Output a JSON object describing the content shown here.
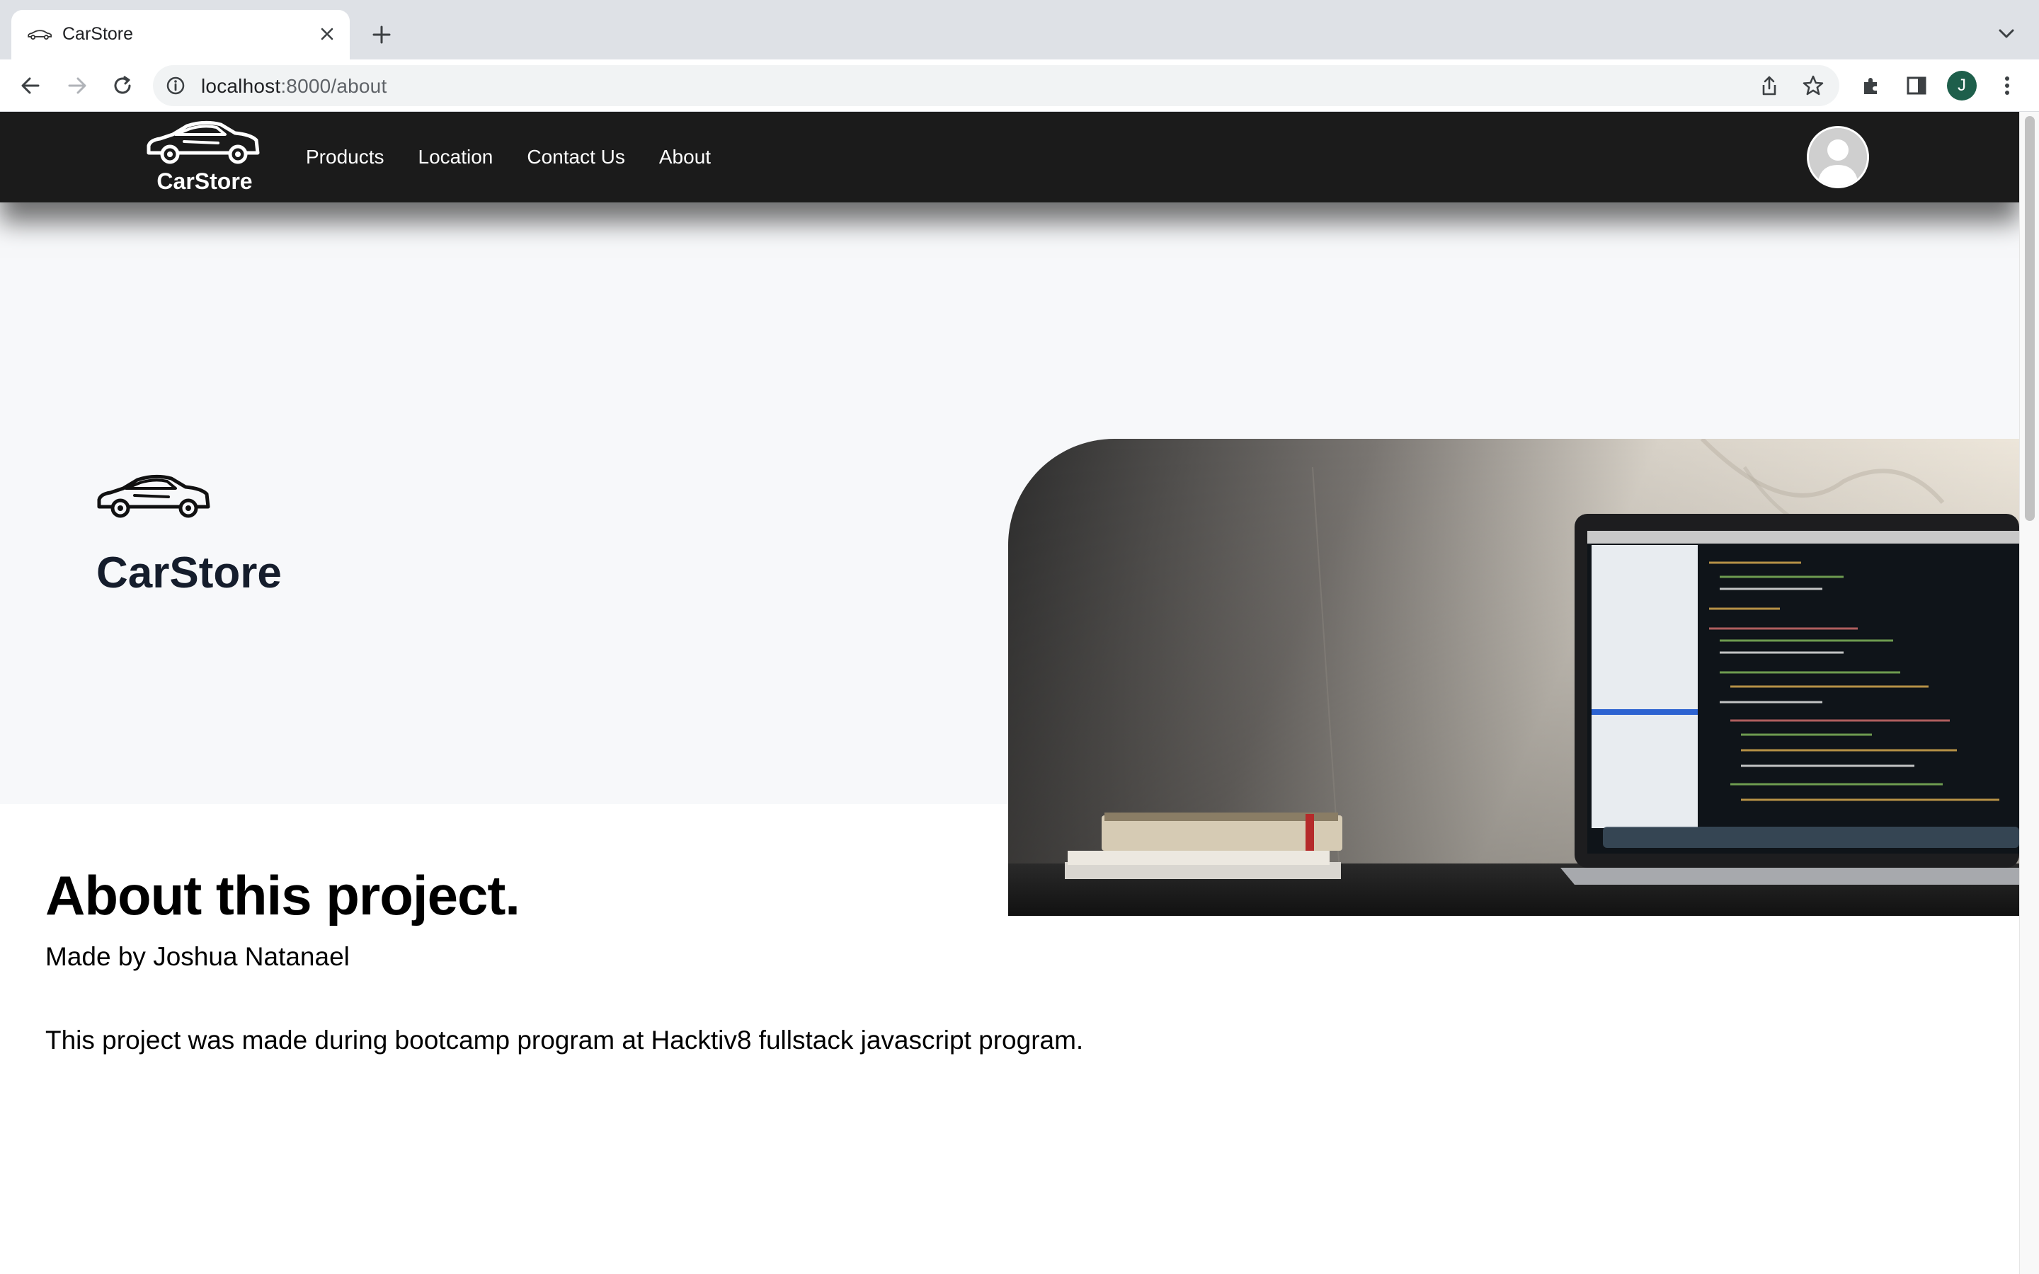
{
  "browser": {
    "tab_title": "CarStore",
    "url_host": "localhost",
    "url_path": ":8000/about",
    "profile_initial": "J"
  },
  "navbar": {
    "brand": "CarStore",
    "links": [
      "Products",
      "Location",
      "Contact Us",
      "About"
    ]
  },
  "hero": {
    "title": "CarStore"
  },
  "about": {
    "title": "About this project.",
    "author": "Made by Joshua Natanael",
    "description": "This project was made during bootcamp program at Hacktiv8 fullstack javascript program."
  },
  "colors": {
    "navbar_bg": "#1b1b1b",
    "hero_bg": "#f7f8fa",
    "hero_title": "#151d2c",
    "chrome_bg": "#dee1e6",
    "profile_bg": "#1e5f4b"
  },
  "icons": [
    "car-icon",
    "close-icon",
    "plus-icon",
    "chevron-down-icon",
    "back-arrow-icon",
    "forward-arrow-icon",
    "reload-icon",
    "info-icon",
    "share-icon",
    "star-icon",
    "extensions-icon",
    "side-panel-icon",
    "more-vert-icon",
    "user-avatar-icon"
  ]
}
